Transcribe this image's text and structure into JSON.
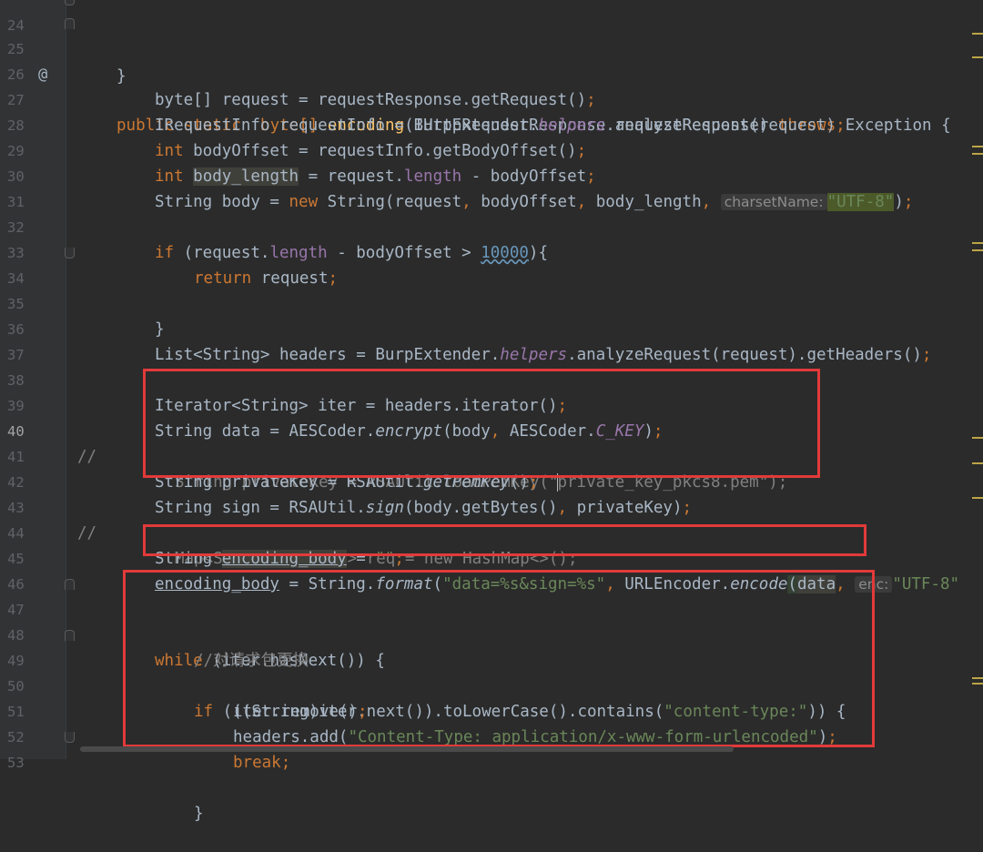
{
  "line_numbers": [
    "24",
    "25",
    "26",
    "27",
    "28",
    "29",
    "30",
    "31",
    "32",
    "33",
    "34",
    "35",
    "36",
    "37",
    "38",
    "39",
    "40",
    "41",
    "42",
    "43",
    "44",
    "45",
    "46",
    "47",
    "48",
    "49",
    "50",
    "51",
    "52",
    "53"
  ],
  "current_line": "40",
  "gutter_marker": "@",
  "code": {
    "l25": {
      "mods": "public static  ",
      "type": "byte[] ",
      "name": "encoding",
      "params": "(IHttpRequestResponse requestResponse) ",
      "throws": "throws",
      "rest": " Exception {"
    },
    "l26": {
      "a": "byte[] request = requestResponse.getRequest()",
      "semi": ";"
    },
    "l27": {
      "a": "IRequestInfo requestInfo = BurpExtender.",
      "b": "helpers",
      "c": ".analyzeRequest(request)",
      "semi": ";"
    },
    "l28": {
      "kw": "int",
      "a": " bodyOffset = requestInfo.getBodyOffset()",
      "semi": ";"
    },
    "l29": {
      "kw": "int",
      "a": " ",
      "b": "body_length",
      "c": " = request.",
      "d": "length",
      "e": " - bodyOffset",
      "semi": ";"
    },
    "l30": {
      "a": "String body = ",
      "kw": "new",
      "b": " String(request",
      "c1": ",",
      "c": " bodyOffset",
      "c2": ",",
      "d": " body_length",
      "c3": ",",
      "hint": "charsetName:",
      "str": "\"UTF-8\"",
      "e": ")",
      "semi": ";"
    },
    "l32": {
      "kw": "if",
      "a": " (request.",
      "b": "length",
      "c": " - bodyOffset > ",
      "num": "10000",
      "d": "){"
    },
    "l33": {
      "kw": "return",
      "a": " request",
      "semi": ";"
    },
    "l34": {
      "a": "}"
    },
    "l36": {
      "a": "List<String> headers = BurpExtender.",
      "b": "helpers",
      "c": ".analyzeRequest(request).getHeaders()",
      "semi": ";"
    },
    "l38": {
      "a": "Iterator<String> iter = headers.iterator()",
      "semi": ";"
    },
    "l39": {
      "a": "String data = AESCoder.",
      "b": "encrypt",
      "c": "(body",
      "c1": ",",
      "d": " AESCoder.",
      "e": "C_KEY",
      "f": ")",
      "semi": ";"
    },
    "l40": {
      "comment": "//",
      "a": "String privateKey = RSAUtil.loadPemKey(\"",
      "b": "private_key_pkcs8.pem\");"
    },
    "l41": {
      "a": "String privateKey = RSAUtil.",
      "b": "getPemKey",
      "c": "()",
      "semi": ";"
    },
    "l42": {
      "a": "String sign = RSAUtil.",
      "b": "sign",
      "c": "(body.getBytes()",
      "c1": ",",
      "d": " privateKey)",
      "semi": ";"
    },
    "l43": {
      "comment": "//",
      "a": "Map<String, String> req = new HashMap<>();"
    },
    "l44": {
      "a": "String ",
      "b": "encoding_body",
      "c": " = ",
      "str": "\"\"",
      "semi": ";"
    },
    "l45": {
      "a": "encoding_body",
      "b": " = String.",
      "c": "format",
      "d": "(",
      "str": "\"data=%s&sign=%s\"",
      "c1": ",",
      "e": " URLEncoder.",
      "f": "encode",
      "g": "(",
      "h": "data",
      "c2": ",",
      "hint": "enc:",
      "str2": "\"UTF-8\""
    },
    "l47": {
      "kw": "while",
      "a": " (iter.hasNext()) {"
    },
    "l48": {
      "a": "//对请求包更换"
    },
    "l49": {
      "kw": "if",
      "a": " (((String)iter.next()).toLowerCase().contains(",
      "str": "\"content-type:\"",
      "b": ")) {"
    },
    "l50": {
      "a": "iter.remove()",
      "semi": ";"
    },
    "l51": {
      "a": "headers.add(",
      "str": "\"Content-Type: application/x-www-form-urlencoded\"",
      "b": ")",
      "semi": ";"
    },
    "l52": {
      "kw": "break",
      "semi": ";"
    },
    "l53": {
      "a": "}"
    }
  },
  "colors": {
    "background": "#2b2b2b",
    "keyword": "#cc7832",
    "method_decl": "#ffc66d",
    "string": "#6a8759",
    "field": "#9876aa",
    "comment": "#808080",
    "number": "#6897bb",
    "highlight_box": "#e23a3a"
  }
}
